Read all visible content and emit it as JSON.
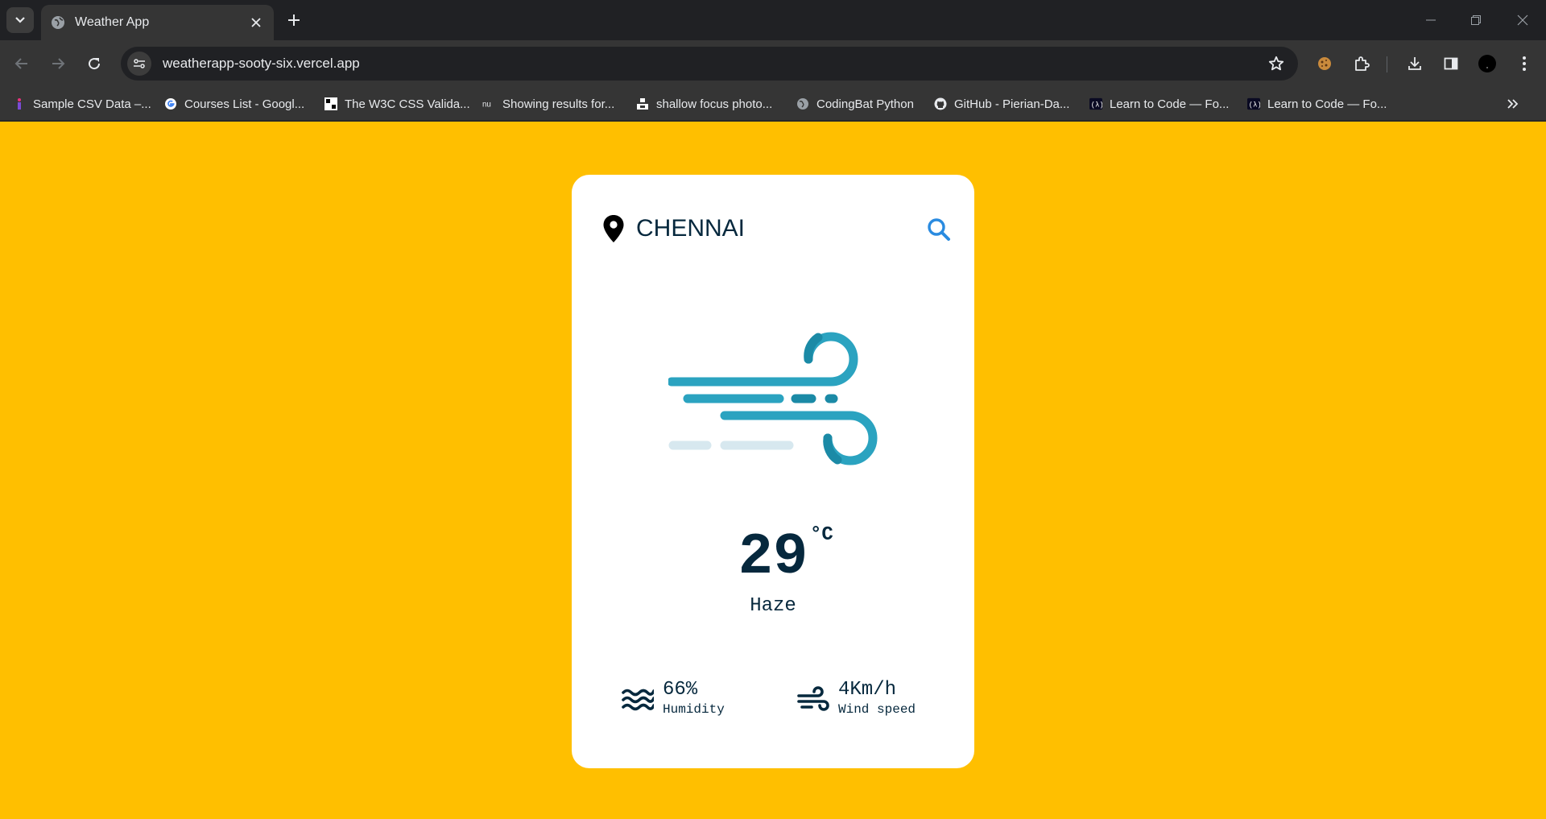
{
  "browser": {
    "tab_title": "Weather App",
    "url": "weatherapp-sooty-six.vercel.app",
    "bookmarks": [
      {
        "label": "Sample CSV Data –...",
        "icon": "csv-icon"
      },
      {
        "label": "Courses List - Googl...",
        "icon": "google-icon"
      },
      {
        "label": "The W3C CSS Valida...",
        "icon": "w3c-icon"
      },
      {
        "label": "Showing results for...",
        "icon": "nu-icon"
      },
      {
        "label": "shallow focus photo...",
        "icon": "unsplash-icon"
      },
      {
        "label": "CodingBat Python",
        "icon": "globe-icon"
      },
      {
        "label": "GitHub - Pierian-Da...",
        "icon": "github-icon"
      },
      {
        "label": "Learn to Code — Fo...",
        "icon": "freecodecamp-icon"
      },
      {
        "label": "Learn to Code — Fo...",
        "icon": "freecodecamp-icon"
      }
    ]
  },
  "app": {
    "city": "CHENNAI",
    "temperature": "29",
    "unit": "°C",
    "description": "Haze",
    "humidity": {
      "value": "66%",
      "label": "Humidity"
    },
    "wind": {
      "value": "4Km/h",
      "label": "Wind speed"
    },
    "weather_icon": "wind-icon",
    "colors": {
      "background": "#ffbf00",
      "card": "#ffffff",
      "text": "#06283d",
      "accent": "#2a8be0",
      "wind": "#2ba3c0"
    }
  }
}
